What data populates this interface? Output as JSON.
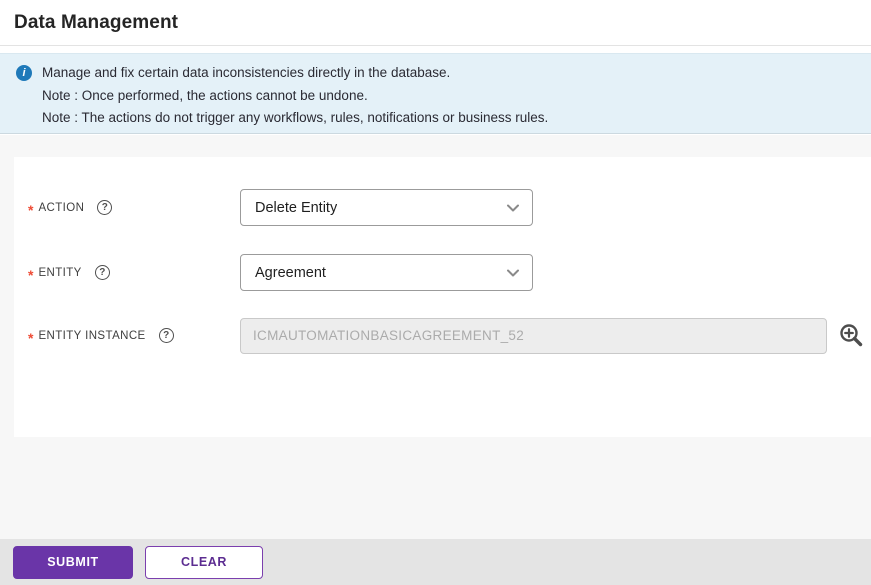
{
  "page": {
    "title": "Data Management"
  },
  "banner": {
    "lines": [
      "Manage and fix certain data inconsistencies directly in the database.",
      "Note : Once performed, the actions cannot be undone.",
      "Note : The actions do not trigger any workflows, rules, notifications or business rules."
    ]
  },
  "form": {
    "required_marker": "*",
    "help_glyph": "?",
    "fields": [
      {
        "label": "ACTION",
        "type": "select",
        "value": "Delete Entity"
      },
      {
        "label": "ENTITY",
        "type": "select",
        "value": "Agreement"
      },
      {
        "label": "ENTITY INSTANCE",
        "type": "text",
        "value": "ICMAUTOMATIONBASICAGREEMENT_52",
        "disabled": true
      }
    ]
  },
  "actions": {
    "submit_label": "SUBMIT",
    "clear_label": "CLEAR"
  },
  "colors": {
    "accent_purple": "#6a35a8",
    "banner_bg": "#e4f1f8",
    "info_blue": "#1e79b9",
    "required_red": "#ee4b35",
    "footer_bar_bg": "#e4e4e4"
  }
}
